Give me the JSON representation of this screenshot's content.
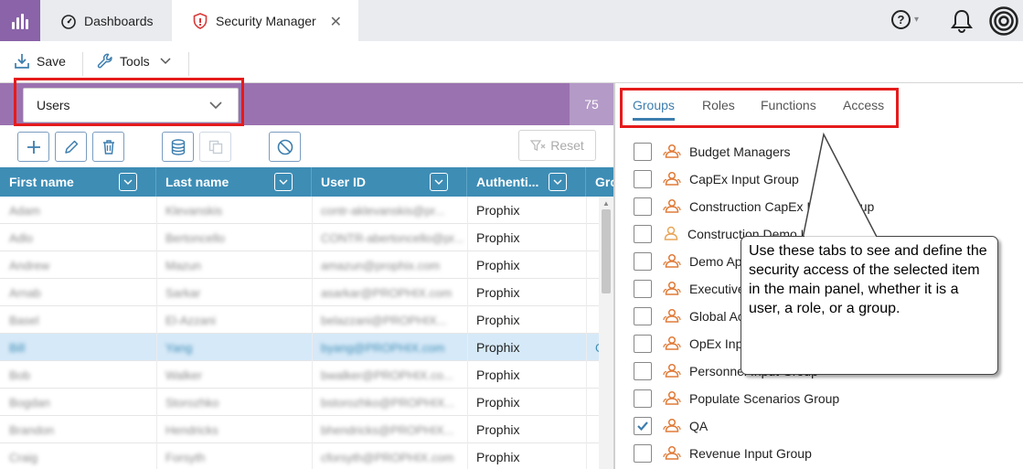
{
  "topbar": {
    "tabs": [
      {
        "label": "Dashboards",
        "icon": "gauge-icon"
      },
      {
        "label": "Security Manager",
        "icon": "shield-icon",
        "close_glyph": "✕"
      }
    ],
    "help_glyph": "?",
    "help_chevron": "▾"
  },
  "toolbar": {
    "save_label": "Save",
    "tools_label": "Tools"
  },
  "left": {
    "selector_value": "Users",
    "count": "75",
    "reset_label": "Reset",
    "columns": [
      "First name",
      "Last name",
      "User ID",
      "Authenti...",
      "Gro"
    ],
    "rows": [
      {
        "first": "Adam",
        "last": "Klevanskis",
        "userid": "contr-aklevanskis@pr...",
        "auth": "Prophix",
        "selected": false
      },
      {
        "first": "Adlo",
        "last": "Bertoncello",
        "userid": "CONTR-abertoncello@pr...",
        "auth": "Prophix",
        "selected": false
      },
      {
        "first": "Andrew",
        "last": "Mazun",
        "userid": "amazun@prophix.com",
        "auth": "Prophix",
        "selected": false
      },
      {
        "first": "Arnab",
        "last": "Sarkar",
        "userid": "asarkar@PROPHIX.com",
        "auth": "Prophix",
        "selected": false
      },
      {
        "first": "Basel",
        "last": "El-Azzani",
        "userid": "belazzani@PROPHIX...",
        "auth": "Prophix",
        "selected": false
      },
      {
        "first": "Bill",
        "last": "Yang",
        "userid": "byang@PROPHIX.com",
        "auth": "Prophix",
        "selected": true,
        "extra": "G"
      },
      {
        "first": "Bob",
        "last": "Walker",
        "userid": "bwalker@PROPHIX.co...",
        "auth": "Prophix",
        "selected": false
      },
      {
        "first": "Bogdan",
        "last": "Storozhko",
        "userid": "bstorozhko@PROPHIX...",
        "auth": "Prophix",
        "selected": false
      },
      {
        "first": "Brandon",
        "last": "Hendricks",
        "userid": "bhendricks@PROPHIX...",
        "auth": "Prophix",
        "selected": false
      },
      {
        "first": "Craig",
        "last": "Forsyth",
        "userid": "cforsyth@PROPHIX.com",
        "auth": "Prophix",
        "selected": false
      }
    ]
  },
  "right": {
    "tabs": [
      "Groups",
      "Roles",
      "Functions",
      "Access"
    ],
    "active_tab": "Groups",
    "groups": [
      {
        "label": "Budget Managers",
        "checked": false
      },
      {
        "label": "CapEx Input Group",
        "checked": false
      },
      {
        "label": "Construction CapEx Input Group",
        "checked": false
      },
      {
        "label": "Construction Demo User",
        "checked": false
      },
      {
        "label": "Demo Ap",
        "checked": false
      },
      {
        "label": "Executive",
        "checked": false
      },
      {
        "label": "Global Ac",
        "checked": false
      },
      {
        "label": "OpEx Inp",
        "checked": false
      },
      {
        "label": "Personnel Input Group",
        "checked": false
      },
      {
        "label": "Populate Scenarios Group",
        "checked": false
      },
      {
        "label": "QA",
        "checked": true
      },
      {
        "label": "Revenue Input Group",
        "checked": false
      }
    ]
  },
  "callout": {
    "text": "Use these tabs to see and define the security access of the selected item in the main panel, whether it is a user, a role, or a group."
  },
  "colors": {
    "brand_purple": "#9b72b0",
    "grid_header": "#3d8db5",
    "highlight_red": "#e51b1b",
    "group_icon": "#e07b39"
  }
}
